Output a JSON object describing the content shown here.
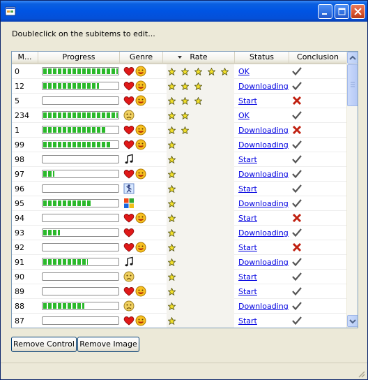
{
  "window": {
    "title": ""
  },
  "hint": "Doubleclick on the subitems to edit...",
  "columns": [
    {
      "label": "M..."
    },
    {
      "label": "Progress"
    },
    {
      "label": "Genre"
    },
    {
      "label": "Rate"
    },
    {
      "label": "Status"
    },
    {
      "label": "Conclusion"
    }
  ],
  "rows": [
    {
      "m": "0",
      "progress": 1.0,
      "genre": [
        "heart",
        "smile"
      ],
      "rate": 5,
      "status": "OK",
      "conclusion": "check"
    },
    {
      "m": "12",
      "progress": 0.75,
      "genre": [
        "heart",
        "smile"
      ],
      "rate": 3,
      "status": "Downloading",
      "conclusion": "check"
    },
    {
      "m": "5",
      "progress": 0.0,
      "genre": [
        "heart",
        "smile"
      ],
      "rate": 3,
      "status": "Start",
      "conclusion": "cross"
    },
    {
      "m": "234",
      "progress": 1.0,
      "genre": [
        "sad"
      ],
      "rate": 2,
      "status": "OK",
      "conclusion": "check"
    },
    {
      "m": "1",
      "progress": 0.85,
      "genre": [
        "heart",
        "smile"
      ],
      "rate": 2,
      "status": "Downloading",
      "conclusion": "cross"
    },
    {
      "m": "99",
      "progress": 0.9,
      "genre": [
        "heart",
        "smile"
      ],
      "rate": 1,
      "status": "Downloading",
      "conclusion": "check"
    },
    {
      "m": "98",
      "progress": 0.0,
      "genre": [
        "music"
      ],
      "rate": 1,
      "status": "Start",
      "conclusion": "check"
    },
    {
      "m": "97",
      "progress": 0.15,
      "genre": [
        "heart",
        "smile"
      ],
      "rate": 1,
      "status": "Downloading",
      "conclusion": "check"
    },
    {
      "m": "96",
      "progress": 0.0,
      "genre": [
        "dance"
      ],
      "rate": 1,
      "status": "Start",
      "conclusion": "check"
    },
    {
      "m": "95",
      "progress": 0.65,
      "genre": [
        "windows"
      ],
      "rate": 1,
      "status": "Downloading",
      "conclusion": "check"
    },
    {
      "m": "94",
      "progress": 0.0,
      "genre": [
        "heart",
        "smile"
      ],
      "rate": 1,
      "status": "Start",
      "conclusion": "cross"
    },
    {
      "m": "93",
      "progress": 0.22,
      "genre": [
        "heart"
      ],
      "rate": 1,
      "status": "Downloading",
      "conclusion": "check"
    },
    {
      "m": "92",
      "progress": 0.0,
      "genre": [
        "heart",
        "smile"
      ],
      "rate": 1,
      "status": "Start",
      "conclusion": "cross"
    },
    {
      "m": "91",
      "progress": 0.6,
      "genre": [
        "music"
      ],
      "rate": 1,
      "status": "Downloading",
      "conclusion": "check"
    },
    {
      "m": "90",
      "progress": 0.0,
      "genre": [
        "sad"
      ],
      "rate": 1,
      "status": "Start",
      "conclusion": "check"
    },
    {
      "m": "89",
      "progress": 0.0,
      "genre": [
        "heart",
        "smile"
      ],
      "rate": 1,
      "status": "Start",
      "conclusion": "check"
    },
    {
      "m": "88",
      "progress": 0.55,
      "genre": [
        "sad"
      ],
      "rate": 1,
      "status": "Downloading",
      "conclusion": "check"
    },
    {
      "m": "87",
      "progress": 0.0,
      "genre": [
        "heart",
        "smile"
      ],
      "rate": 1,
      "status": "Start",
      "conclusion": "check"
    }
  ],
  "buttons": {
    "remove_control": "Remove Control",
    "remove_image": "Remove Image"
  },
  "colors": {
    "progress_fill": "#2bb92b",
    "link": "#0000e0",
    "titlebar": "#0054e3",
    "close_button": "#d9542f"
  },
  "icons": {
    "heart": "heart-icon",
    "smile": "smiley-icon",
    "sad": "sad-face-icon",
    "music": "music-note-icon",
    "dance": "dancer-icon",
    "windows": "windows-logo-icon",
    "star": "star-icon",
    "check": "check-icon",
    "cross": "cross-icon"
  }
}
